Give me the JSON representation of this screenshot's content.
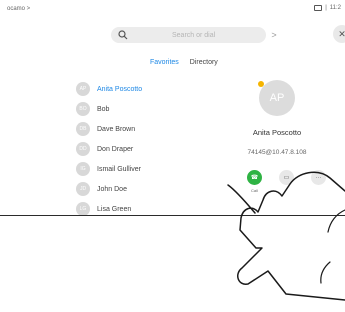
{
  "device_label": "ocamo >",
  "clock": "11:2",
  "search": {
    "placeholder": "Search or dial"
  },
  "icons": {
    "search": "search-icon",
    "chevron": "chevron-right-icon",
    "close": "close-icon",
    "camera": "camera-icon",
    "call": "phone-icon",
    "more": "more-icon"
  },
  "tabs": [
    {
      "label": "Favorites",
      "active": true
    },
    {
      "label": "Directory",
      "active": false
    }
  ],
  "contacts": [
    {
      "initials": "AP",
      "name": "Anita Poscotto",
      "selected": true
    },
    {
      "initials": "BO",
      "name": "Bob"
    },
    {
      "initials": "DB",
      "name": "Dave Brown"
    },
    {
      "initials": "DD",
      "name": "Don Draper"
    },
    {
      "initials": "IG",
      "name": "Ismail Gulliver"
    },
    {
      "initials": "JD",
      "name": "John Doe"
    },
    {
      "initials": "LG",
      "name": "Lisa Green"
    }
  ],
  "detail": {
    "initials": "AP",
    "name": "Anita Poscotto",
    "address": "74145@10.47.8.108"
  },
  "actions": [
    {
      "label": "Call",
      "glyph": "☎"
    },
    {
      "label": "",
      "glyph": "···"
    }
  ],
  "colors": {
    "accent": "#1e88e5",
    "call_green": "#2fb344",
    "favorite_star": "#f5b400"
  }
}
